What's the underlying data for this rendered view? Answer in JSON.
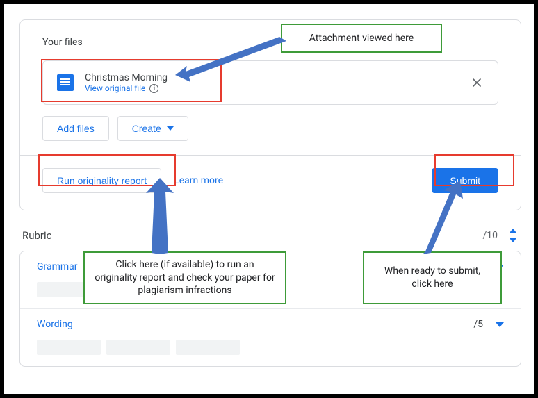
{
  "files": {
    "heading": "Your files",
    "attachment": {
      "title": "Christmas Morning",
      "view_link_label": "View original file"
    },
    "add_files_label": "Add files",
    "create_label": "Create"
  },
  "actions": {
    "run_report_label": "Run originality report",
    "learn_more_label": "Learn more",
    "submit_label": "Submit"
  },
  "rubric": {
    "heading": "Rubric",
    "total_score": "/10",
    "items": [
      {
        "name": "Grammar",
        "points": "",
        "placeholders": [
          92
        ]
      },
      {
        "name": "Wording",
        "points": "/5",
        "placeholders": [
          92,
          92,
          92
        ]
      }
    ]
  },
  "annotations": {
    "attachment_callout": "Attachment viewed here",
    "originality_callout": "Click here (if available) to run an originality report and check your paper for plagiarism infractions",
    "submit_callout": "When ready to submit, click here"
  }
}
